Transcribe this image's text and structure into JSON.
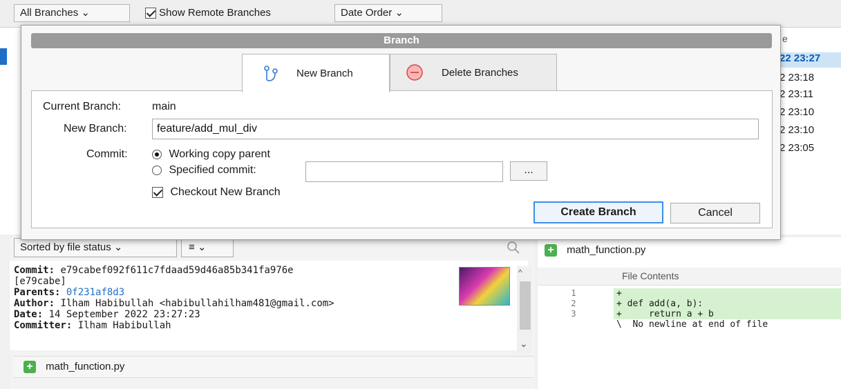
{
  "toolbar": {
    "branch_filter": "All Branches",
    "show_remote_label": "Show Remote Branches",
    "show_remote_checked": true,
    "order_select": "Date Order"
  },
  "commit_list": {
    "date_header": "e",
    "dates": [
      "22 23:27",
      "2 23:18",
      "2 23:11",
      "2 23:10",
      "2 23:10",
      "2 23:05"
    ]
  },
  "dialog": {
    "title": "Branch",
    "tabs": [
      {
        "label": "New Branch",
        "icon": "branch-icon",
        "active": true
      },
      {
        "label": "Delete Branches",
        "icon": "minus-circle-icon",
        "active": false
      }
    ],
    "current_branch_label": "Current Branch:",
    "current_branch_value": "main",
    "new_branch_label": "New Branch:",
    "new_branch_value": "feature/add_mul_div",
    "commit_label": "Commit:",
    "working_copy_label": "Working copy parent",
    "specified_commit_label": "Specified commit:",
    "specified_commit_value": "",
    "browse_label": "...",
    "checkout_label": "Checkout New Branch",
    "checkout_checked": true,
    "create_button": "Create Branch",
    "cancel_button": "Cancel"
  },
  "file_panel": {
    "sort_label": "Sorted by file status",
    "list_icon": "list-icon"
  },
  "commit_info": {
    "commit_label": "Commit:",
    "commit_hash": "e79cabef092f611c7fdaad59d46a85b341fa976e",
    "short_hash": "[e79cabe]",
    "parents_label": "Parents:",
    "parents_value": "0f231af8d3",
    "author_label": "Author:",
    "author_value": "Ilham Habibullah <habibullahilham481@gmail.com>",
    "date_label": "Date:",
    "date_value": "14 September 2022 23:27:23",
    "committer_label": "Committer:",
    "committer_value": "Ilham Habibullah"
  },
  "changed_file": "math_function.py",
  "diff": {
    "file_name": "math_function.py",
    "contents_header": "File Contents",
    "line_numbers": [
      "1",
      "2",
      "3"
    ],
    "lines": [
      {
        "text": "+",
        "added": true
      },
      {
        "text": "+ def add(a, b):",
        "added": true
      },
      {
        "text": "+     return a + b",
        "added": true
      },
      {
        "text": "\\  No newline at end of file",
        "added": false
      }
    ]
  },
  "colors": {
    "accent": "#3b8ee8",
    "selection": "#1f6fc9",
    "added_line": "#d6f1cf",
    "add_badge": "#4caf50"
  }
}
